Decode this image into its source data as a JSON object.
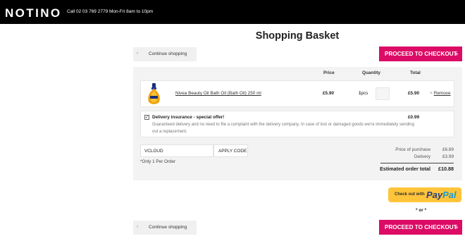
{
  "header": {
    "logo": "NOTINO",
    "phone": "Call 02 03 769 2779 Mon-Fri 8am to 10pm"
  },
  "page": {
    "title": "Shopping Basket",
    "continue_label": "Continue shopping",
    "checkout_label": "PROCEED TO CHECKOUT"
  },
  "table": {
    "headers": {
      "price": "Price",
      "quantity": "Quantity",
      "total": "Total"
    }
  },
  "item": {
    "name": "Nivea Beauty Oil Bath Oil (Bath Oil) 250 ml",
    "price": "£5.90",
    "quantity": "1",
    "unit": "pcs",
    "total": "£5.90",
    "remove_label": "Remove"
  },
  "insurance": {
    "checked": true,
    "title": "Delivery insurance - special offer!",
    "description": "Guaranteed delivery and no need to file a complaint with the delivery company. In case of lost or damaged goods we're immediately sending out a replacement.",
    "price": "£0.99"
  },
  "voucher": {
    "value": "VCLOUD",
    "apply_label": "APPLY CODE",
    "note": "*Only 1 Per Order"
  },
  "summary": {
    "purchase_label": "Price of purchase",
    "purchase_value": "£6.89",
    "delivery_label": "Delivery",
    "delivery_value": "£3.99",
    "total_label": "Estimated order total",
    "total_value": "£10.88"
  },
  "paypal": {
    "prefix": "Check out with",
    "brand_pay": "Pay",
    "brand_pal": "Pal"
  },
  "or_label": "* or *",
  "colors": {
    "accent": "#dc0b66",
    "paypal_yellow": "#ffc439",
    "header_bg": "#000000"
  }
}
